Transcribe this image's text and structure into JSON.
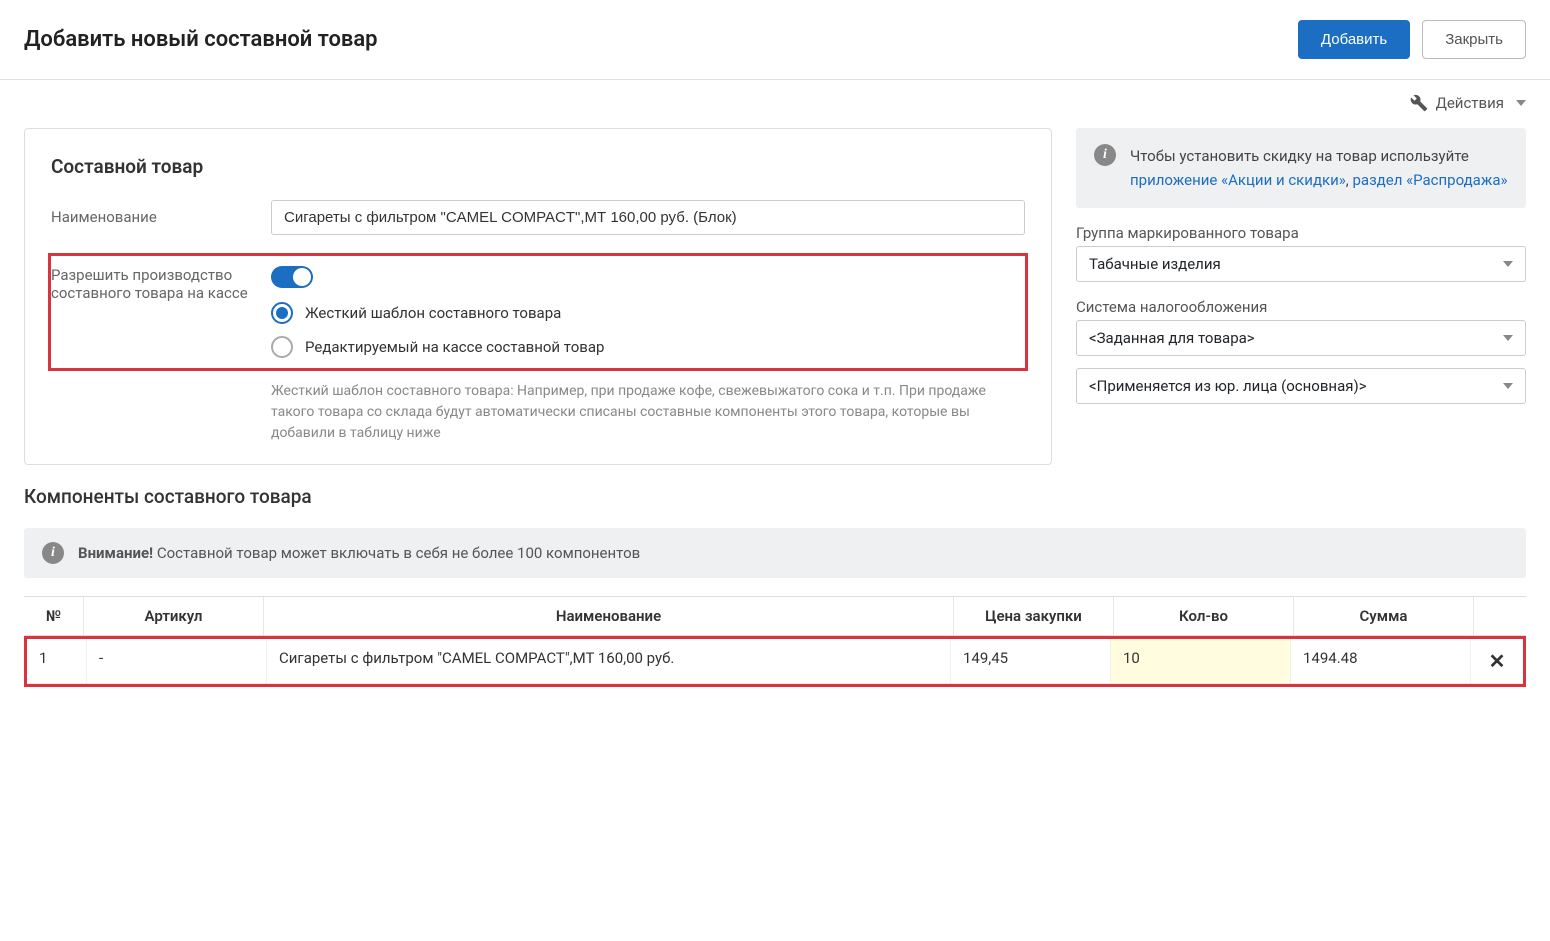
{
  "header": {
    "title": "Добавить новый составной товар",
    "add_btn": "Добавить",
    "close_btn": "Закрыть"
  },
  "actions_label": "Действия",
  "panel": {
    "title": "Составной товар",
    "name_label": "Наименование",
    "name_value": "Сигареты с фильтром \"CAMEL COMPACT\",МТ 160,00 руб. (Блок)",
    "allow_label": "Разрешить производство составного товара на кассе",
    "radio_strict": "Жесткий шаблон составного товара",
    "radio_editable": "Редактируемый на кассе составной товар",
    "help_text": "Жесткий шаблон составного товара: Например, при продаже кофе, свежевыжатого сока и т.п. При продаже такого товара со склада будут автоматически списаны составные компоненты этого товара, которые вы добавили в таблицу ниже"
  },
  "side": {
    "info_prefix": "Чтобы установить скидку на товар используйте ",
    "info_link1": "приложение «Акции и скидки»",
    "info_mid": ", ",
    "info_link2": "раздел «Распродажа»",
    "group_label": "Группа маркированного товара",
    "group_value": "Табачные изделия",
    "tax_label": "Система налогообложения",
    "tax_value1": "<Заданная для товара>",
    "tax_value2": "<Применяется из юр. лица (основная)>"
  },
  "components": {
    "title": "Компоненты составного товара",
    "warning_bold": "Внимание!",
    "warning_text": " Составной товар может включать в себя не более 100 компонентов",
    "headers": {
      "num": "№",
      "art": "Артикул",
      "name": "Наименование",
      "price": "Цена закупки",
      "qty": "Кол-во",
      "sum": "Сумма"
    },
    "rows": [
      {
        "num": "1",
        "art": "-",
        "name": "Сигареты с фильтром \"CAMEL COMPACT\",МТ 160,00 руб.",
        "price": "149,45",
        "qty": "10",
        "sum": "1494.48"
      }
    ]
  }
}
